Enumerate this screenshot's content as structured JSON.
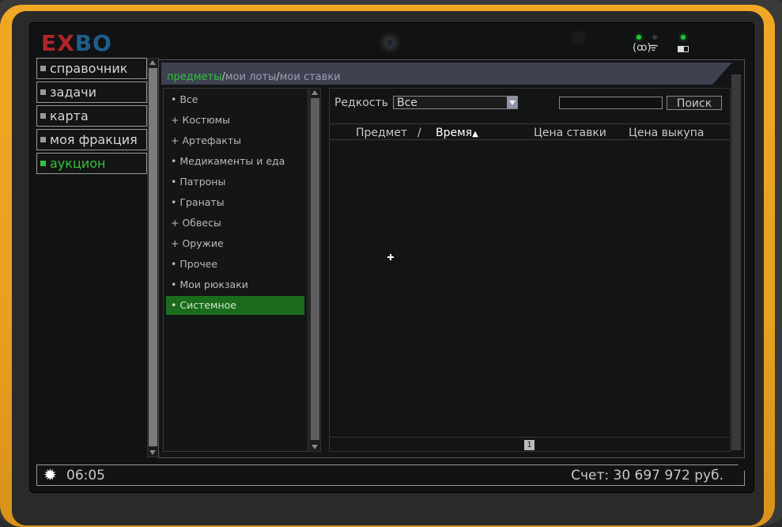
{
  "brand": {
    "logo_part1": "EX",
    "logo_part2": "BO"
  },
  "nav": {
    "items": [
      {
        "label": "справочник",
        "active": false
      },
      {
        "label": "задачи",
        "active": false
      },
      {
        "label": "карта",
        "active": false
      },
      {
        "label": "моя фракция",
        "active": false
      },
      {
        "label": "аукцион",
        "active": true
      }
    ]
  },
  "tabs": {
    "items": [
      {
        "label": "предметы",
        "active": true
      },
      {
        "label": "мои лоты",
        "active": false
      },
      {
        "label": "мои ставки",
        "active": false
      }
    ],
    "separator": "/"
  },
  "categories": [
    {
      "prefix": "•",
      "label": "Все"
    },
    {
      "prefix": "+",
      "label": "Костюмы"
    },
    {
      "prefix": "+",
      "label": "Артефакты"
    },
    {
      "prefix": "•",
      "label": "Медикаменты и еда"
    },
    {
      "prefix": "•",
      "label": "Патроны"
    },
    {
      "prefix": "•",
      "label": "Гранаты"
    },
    {
      "prefix": "+",
      "label": "Обвесы"
    },
    {
      "prefix": "+",
      "label": "Оружие"
    },
    {
      "prefix": "•",
      "label": "Прочее"
    },
    {
      "prefix": "•",
      "label": "Мои рюкзаки"
    },
    {
      "prefix": "•",
      "label": "Системное",
      "active": true
    }
  ],
  "filters": {
    "rarity_label": "Редкость",
    "rarity_value": "Все",
    "search_value": "",
    "search_button": "Поиск"
  },
  "table": {
    "columns": [
      "Предмет",
      "Время",
      "Цена ставки",
      "Цена выкупа"
    ],
    "separator": "/",
    "sorted_column": "Время",
    "sort_indicator": "▲",
    "rows": []
  },
  "pagination": {
    "current_page": "1"
  },
  "status": {
    "time": "06:05",
    "balance": "Счет: 30 697 972 руб."
  },
  "colors": {
    "accent_green": "#2fc43a",
    "active_category_bg": "#1b6b1c",
    "case_yellow": "#e8a020"
  }
}
